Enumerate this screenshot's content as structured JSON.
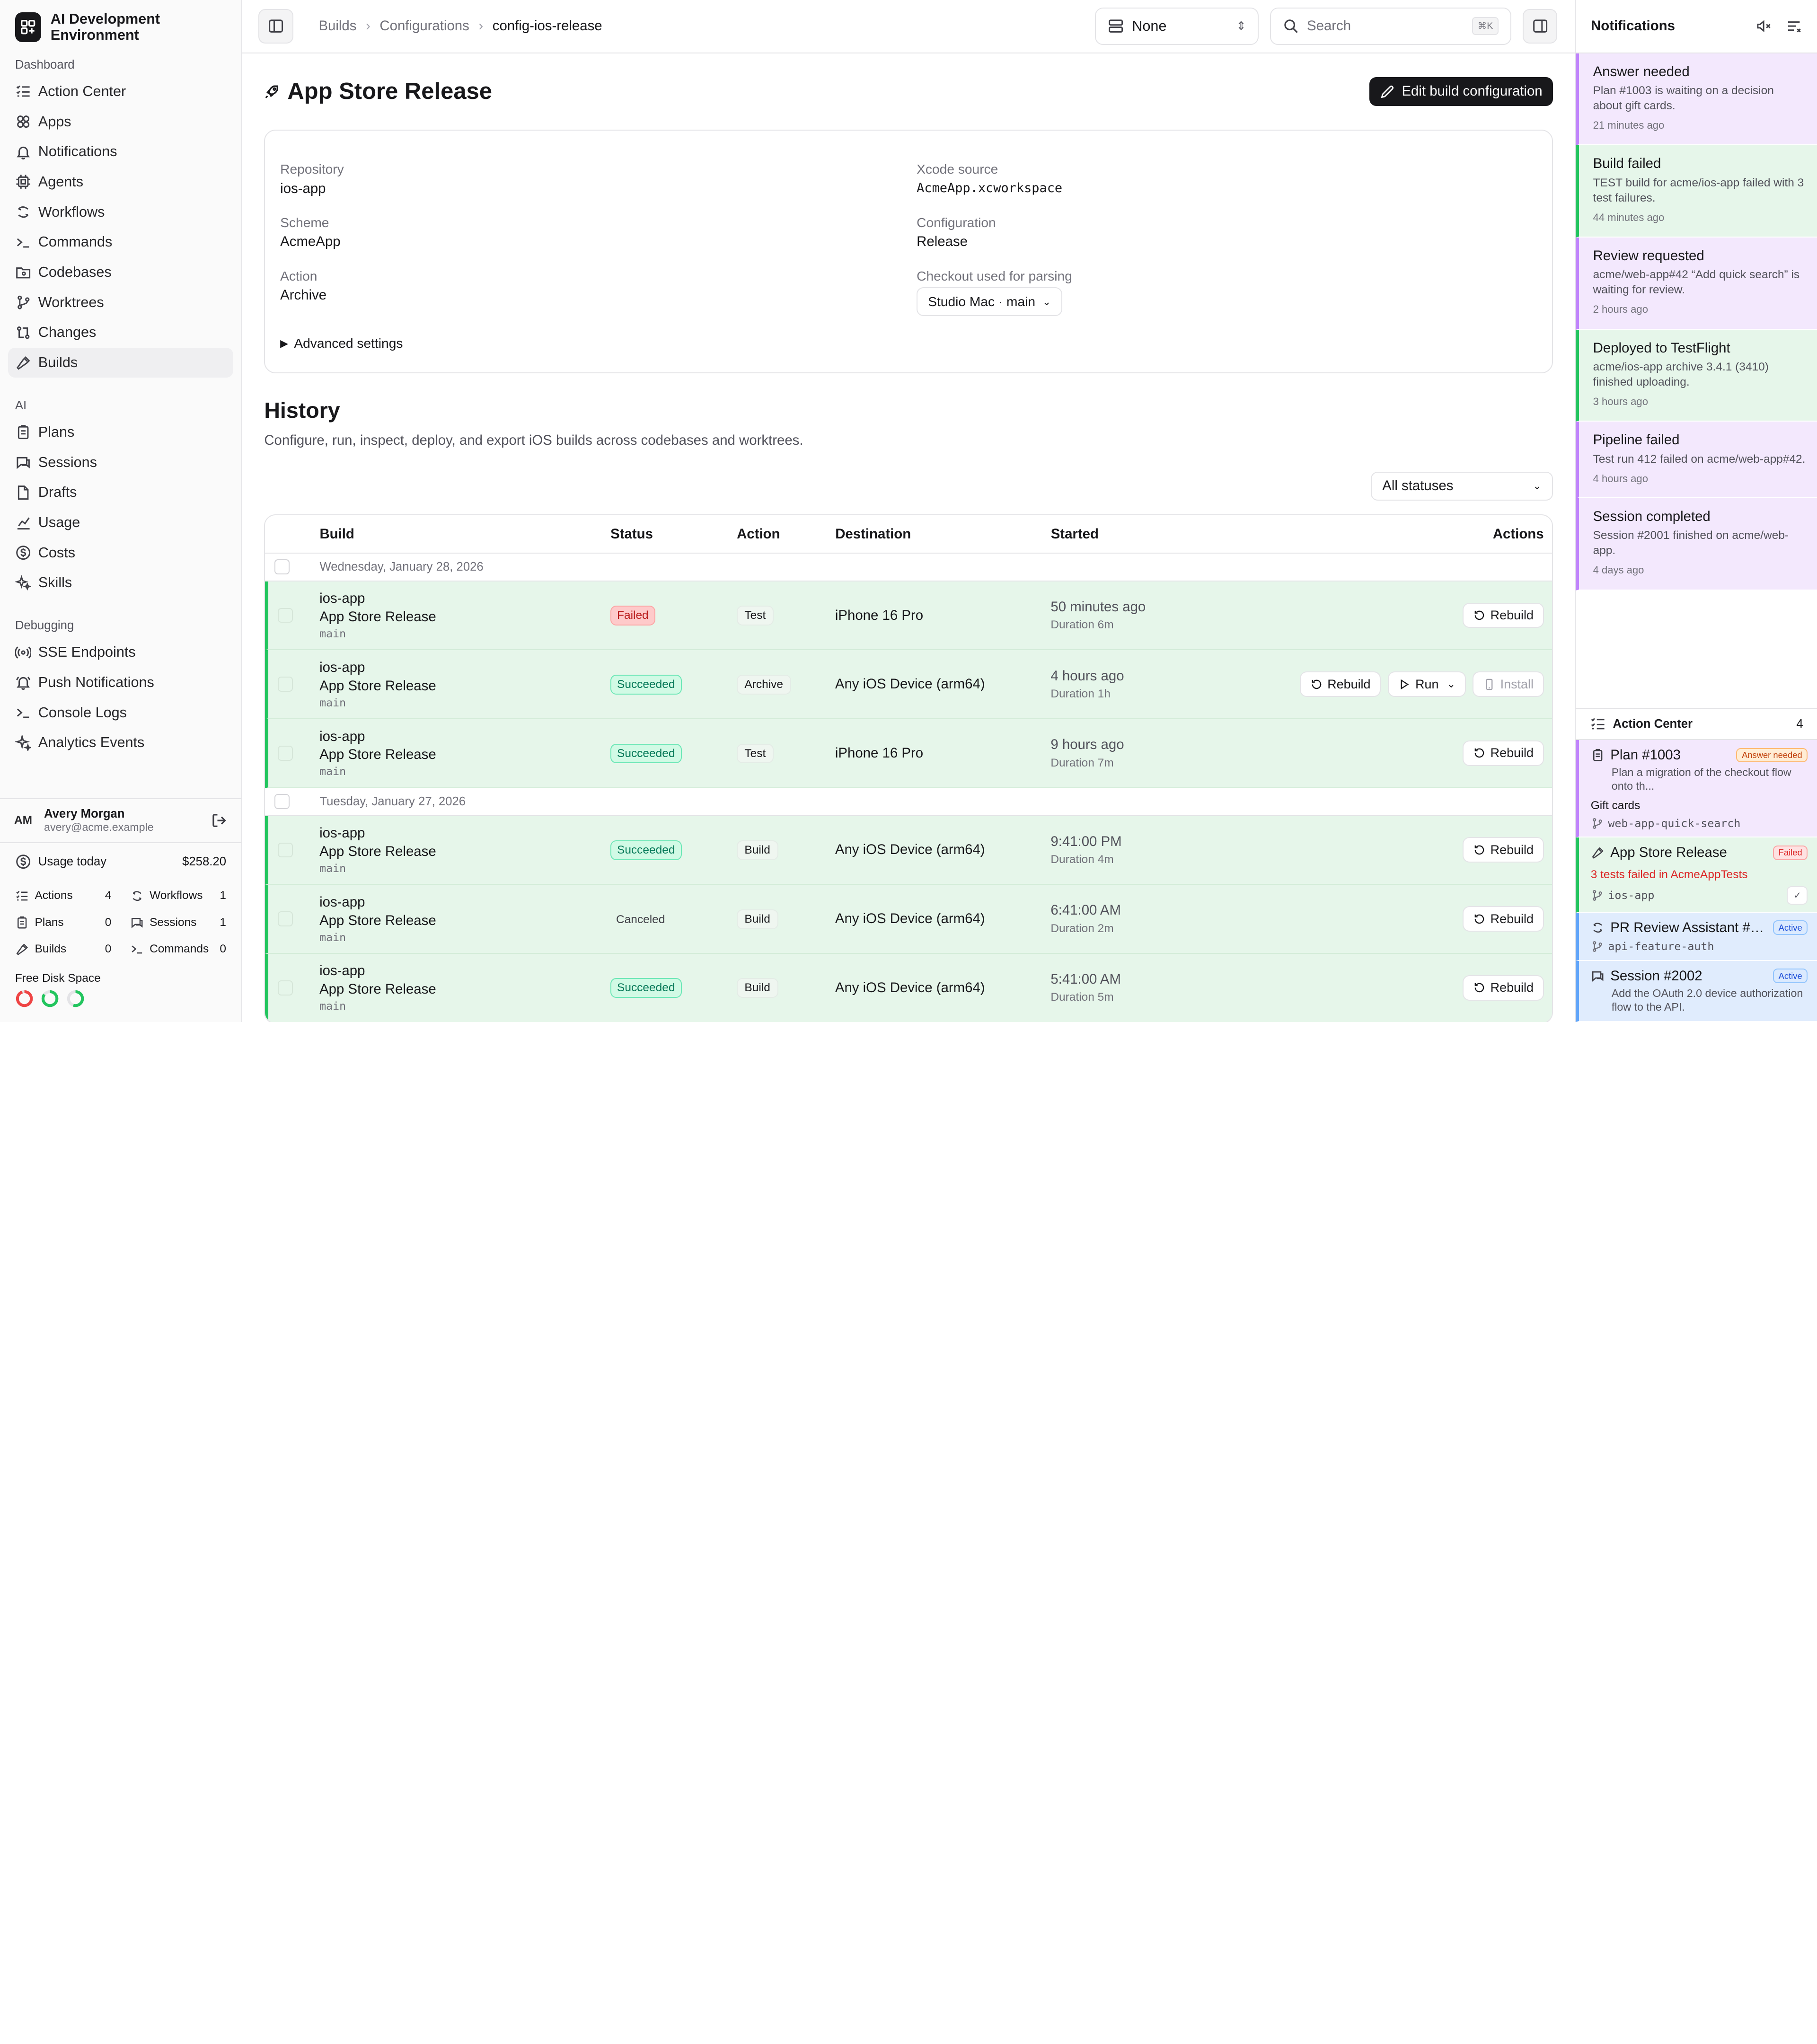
{
  "app": {
    "title": "AI Development Environment"
  },
  "sidebar": {
    "groups": [
      {
        "label": "Dashboard",
        "items": [
          {
            "label": "Action Center",
            "icon": "list-checks-icon"
          },
          {
            "label": "Apps",
            "icon": "apps-icon"
          },
          {
            "label": "Notifications",
            "icon": "bell-icon"
          },
          {
            "label": "Agents",
            "icon": "cpu-icon"
          },
          {
            "label": "Workflows",
            "icon": "workflow-icon"
          },
          {
            "label": "Commands",
            "icon": "terminal-icon"
          },
          {
            "label": "Codebases",
            "icon": "folder-git-icon"
          },
          {
            "label": "Worktrees",
            "icon": "git-branch-icon"
          },
          {
            "label": "Changes",
            "icon": "git-compare-icon"
          },
          {
            "label": "Builds",
            "icon": "hammer-icon",
            "active": true
          }
        ]
      },
      {
        "label": "AI",
        "items": [
          {
            "label": "Plans",
            "icon": "clipboard-icon"
          },
          {
            "label": "Sessions",
            "icon": "chat-icon"
          },
          {
            "label": "Drafts",
            "icon": "file-icon"
          },
          {
            "label": "Usage",
            "icon": "chart-icon"
          },
          {
            "label": "Costs",
            "icon": "dollar-icon"
          },
          {
            "label": "Skills",
            "icon": "sparkles-icon"
          }
        ]
      },
      {
        "label": "Debugging",
        "items": [
          {
            "label": "SSE Endpoints",
            "icon": "radio-icon"
          },
          {
            "label": "Push Notifications",
            "icon": "bell-ring-icon"
          },
          {
            "label": "Console Logs",
            "icon": "terminal-icon"
          },
          {
            "label": "Analytics Events",
            "icon": "sparkle-icon"
          }
        ]
      }
    ],
    "user": {
      "initials": "AM",
      "name": "Avery Morgan",
      "email": "avery@acme.example"
    },
    "usage": {
      "label": "Usage today",
      "amount": "$258.20"
    },
    "stats": [
      {
        "label": "Actions",
        "value": "4"
      },
      {
        "label": "Workflows",
        "value": "1"
      },
      {
        "label": "Plans",
        "value": "0"
      },
      {
        "label": "Sessions",
        "value": "1"
      },
      {
        "label": "Builds",
        "value": "0"
      },
      {
        "label": "Commands",
        "value": "0"
      }
    ],
    "disk": {
      "label": "Free Disk Space",
      "colors": [
        "#ef4444",
        "#22c55e",
        "#22c55e"
      ],
      "levels": [
        0.95,
        0.85,
        0.55
      ]
    }
  },
  "topbar": {
    "breadcrumb": [
      "Builds",
      "Configurations",
      "config-ios-release"
    ],
    "device_select": "None",
    "search_placeholder": "Search",
    "shortcut": "⌘K"
  },
  "page": {
    "title": "App Store Release",
    "edit_button": "Edit build configuration",
    "fields_left": [
      {
        "label": "Repository",
        "value": "ios-app"
      },
      {
        "label": "Scheme",
        "value": "AcmeApp"
      },
      {
        "label": "Action",
        "value": "Archive"
      }
    ],
    "fields_right": [
      {
        "label": "Xcode source",
        "value": "AcmeApp.xcworkspace"
      },
      {
        "label": "Configuration",
        "value": "Release"
      },
      {
        "label": "Checkout used for parsing",
        "value": "Studio Mac · main"
      }
    ],
    "advanced": "Advanced settings"
  },
  "history": {
    "title": "History",
    "description": "Configure, run, inspect, deploy, and export iOS builds across codebases and worktrees.",
    "filter": "All statuses",
    "columns": [
      "Build",
      "Status",
      "Action",
      "Destination",
      "Started",
      "Actions"
    ],
    "groups": [
      {
        "date": "Wednesday, January 28, 2026",
        "rows": [
          {
            "repo": "ios-app",
            "name": "App Store Release",
            "branch": "main",
            "status": "Failed",
            "status_kind": "fail",
            "action": "Test",
            "destination": "iPhone 16 Pro",
            "started": "50 minutes ago",
            "duration": "Duration 6m"
          },
          {
            "repo": "ios-app",
            "name": "App Store Release",
            "branch": "main",
            "status": "Succeeded",
            "status_kind": "ok",
            "action": "Archive",
            "destination": "Any iOS Device (arm64)",
            "started": "4 hours ago",
            "duration": "Duration 1h",
            "extra": true
          },
          {
            "repo": "ios-app",
            "name": "App Store Release",
            "branch": "main",
            "status": "Succeeded",
            "status_kind": "ok",
            "action": "Test",
            "destination": "iPhone 16 Pro",
            "started": "9 hours ago",
            "duration": "Duration 7m"
          }
        ]
      },
      {
        "date": "Tuesday, January 27, 2026",
        "rows": [
          {
            "repo": "ios-app",
            "name": "App Store Release",
            "branch": "main",
            "status": "Succeeded",
            "status_kind": "ok",
            "action": "Build",
            "destination": "Any iOS Device (arm64)",
            "started": "9:41:00 PM",
            "duration": "Duration 4m"
          },
          {
            "repo": "ios-app",
            "name": "App Store Release",
            "branch": "main",
            "status": "Canceled",
            "status_kind": "cancel",
            "action": "Build",
            "destination": "Any iOS Device (arm64)",
            "started": "6:41:00 AM",
            "duration": "Duration 2m"
          },
          {
            "repo": "ios-app",
            "name": "App Store Release",
            "branch": "main",
            "status": "Succeeded",
            "status_kind": "ok",
            "action": "Build",
            "destination": "Any iOS Device (arm64)",
            "started": "5:41:00 AM",
            "duration": "Duration 5m"
          }
        ]
      }
    ],
    "buttons": {
      "rebuild": "Rebuild",
      "run": "Run",
      "install": "Install"
    }
  },
  "notifications": {
    "title": "Notifications",
    "items": [
      {
        "title": "Answer needed",
        "body": "Plan #1003 is waiting on a decision about gift cards.",
        "time": "21 minutes ago",
        "color": "purple"
      },
      {
        "title": "Build failed",
        "body": "TEST build for acme/ios-app failed with 3 test failures.",
        "time": "44 minutes ago",
        "color": "green"
      },
      {
        "title": "Review requested",
        "body": "acme/web-app#42 “Add quick search” is waiting for review.",
        "time": "2 hours ago",
        "color": "purple"
      },
      {
        "title": "Deployed to TestFlight",
        "body": "acme/ios-app archive 3.4.1 (3410) finished uploading.",
        "time": "3 hours ago",
        "color": "green"
      },
      {
        "title": "Pipeline failed",
        "body": "Test run 412 failed on acme/web-app#42.",
        "time": "4 hours ago",
        "color": "purple"
      },
      {
        "title": "Session completed",
        "body": "Session #2001 finished on acme/web-app.",
        "time": "4 days ago",
        "color": "purple"
      }
    ]
  },
  "action_center": {
    "title": "Action Center",
    "count": "4",
    "items": [
      {
        "title": "Plan #1003",
        "badge": "Answer needed",
        "sub": "Plan a migration of the checkout flow onto th...",
        "extra": "Gift cards",
        "branch": "web-app-quick-search"
      },
      {
        "title": "App Store Release",
        "badge": "Failed",
        "sub": "3 tests failed in AcmeAppTests",
        "branch": "ios-app"
      },
      {
        "title": "PR Review Assistant #4...",
        "badge": "Active",
        "branch": "api-feature-auth"
      },
      {
        "title": "Session #2002",
        "badge": "Active",
        "sub": "Add the OAuth 2.0 device authorization flow to the API."
      }
    ]
  }
}
